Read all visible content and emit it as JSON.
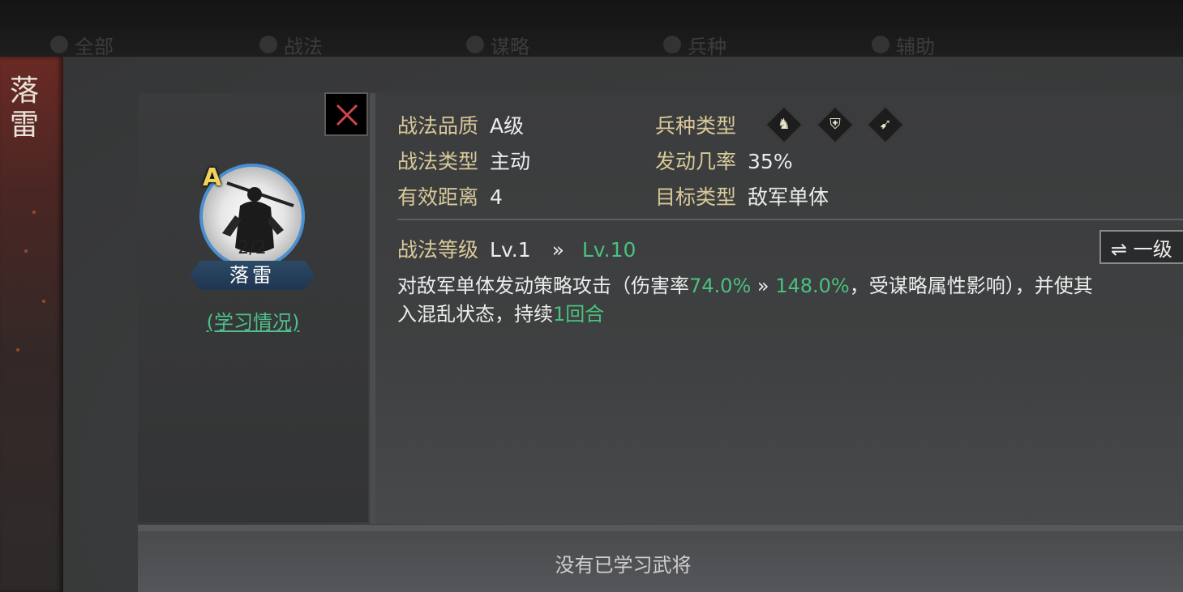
{
  "tabs": [
    "全部",
    "战法",
    "谋略",
    "兵种",
    "辅助"
  ],
  "side_title": "落雷",
  "skill": {
    "grade": "A",
    "learn_count": "2/2",
    "name": "落雷",
    "study_link": "(学习情况)"
  },
  "info": {
    "quality_label": "战法品质",
    "quality_value": "A级",
    "type_label": "战法类型",
    "type_value": "主动",
    "range_label": "有效距离",
    "range_value": "4",
    "troop_label": "兵种类型",
    "troop_icons": [
      "cavalry-icon",
      "shield-icon",
      "bow-icon"
    ],
    "rate_label": "发动几率",
    "rate_value": "35%",
    "target_label": "目标类型",
    "target_value": "敌军单体",
    "level_label": "战法等级",
    "level_from": "Lv.1",
    "level_arrow": "»",
    "level_to": "Lv.10",
    "level_button": "⇌ 一级"
  },
  "description": {
    "part1": "对敌军单体发动策略攻击（伤害率",
    "dmg_from": "74.0%",
    "arrow": " » ",
    "dmg_to": "148.0%",
    "part2": "，受谋略属性影响），并使其",
    "part3": "入混乱状态，持续",
    "duration": "1回合"
  },
  "learned_empty": "没有已学习武将",
  "colors": {
    "accent_green": "#49c27e",
    "label_gold": "#d8c99a",
    "ring_blue": "#4a8fd0"
  }
}
